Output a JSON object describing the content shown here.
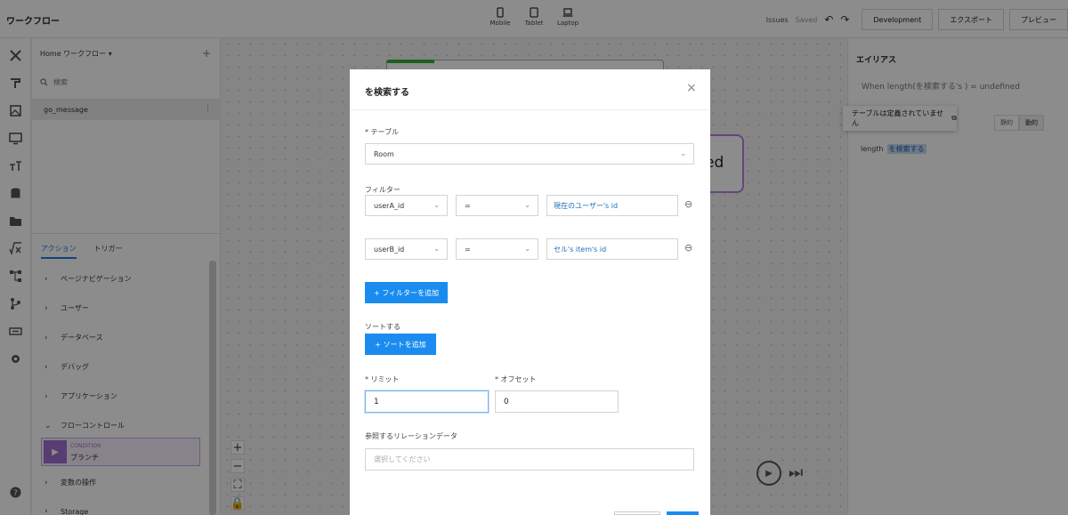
{
  "app": {
    "title": "ワークフロー"
  },
  "devices": [
    {
      "label": "Mobile",
      "icon": "mobile-icon"
    },
    {
      "label": "Tablet",
      "icon": "tablet-icon"
    },
    {
      "label": "Laptop",
      "icon": "laptop-icon"
    }
  ],
  "header": {
    "issues": "Issues",
    "saved": "Saved",
    "undo_icon": "↶",
    "redo_icon": "↷",
    "development": "Development",
    "export": "エクスポート",
    "preview": "プレビュー"
  },
  "left_panel": {
    "header": "Home ワークフロー ▾",
    "add": "+",
    "search_placeholder": "検索",
    "workflow_item": "go_message",
    "workflow_item_menu": "⋮",
    "tabs": [
      "アクション",
      "トリガー"
    ],
    "categories": [
      {
        "chevron": "›",
        "label": "ページナビゲーション"
      },
      {
        "chevron": "›",
        "label": "ユーザー"
      },
      {
        "chevron": "›",
        "label": "データベース"
      },
      {
        "chevron": "›",
        "label": "デバッグ"
      },
      {
        "chevron": "›",
        "label": "アプリケーション"
      },
      {
        "chevron": "⌄",
        "label": "フローコントロール"
      },
      {
        "chevron": "›",
        "label": "変数の操作"
      },
      {
        "chevron": "›",
        "label": "Storage"
      }
    ],
    "branch": {
      "sub": "CONDITION",
      "label": "ブランチ"
    }
  },
  "canvas": {
    "card_text": "ed",
    "zoom": [
      "+",
      "−",
      "⛶",
      "🔒"
    ]
  },
  "right_panel": {
    "title": "エイリアス",
    "when": "When length(を検索する's ) = undefined",
    "toggle": [
      "静的",
      "動的"
    ],
    "length_prefix": "length",
    "length_highlight": "を検索する",
    "tooltip": "テーブルは定義されていません"
  },
  "modal": {
    "title": "を検索する",
    "close": "×",
    "table_label": "* テーブル",
    "table_value": "Room",
    "filter_label": "フィルター",
    "filters": [
      {
        "field": "userA_id",
        "op": "=",
        "value": "現在のユーザー's id"
      },
      {
        "field": "userB_id",
        "op": "=",
        "value": "セル's item's id"
      }
    ],
    "add_filter": "+ フィルターを追加",
    "sort_label": "ソートする",
    "add_sort": "+ ソートを追加",
    "limit_label": "* リミット",
    "limit_value": "1",
    "offset_label": "* オフセット",
    "offset_value": "0",
    "relation_label": "参照するリレーションデータ",
    "relation_placeholder": "選択してください"
  },
  "colors": {
    "accent": "#1a8cf0",
    "purple": "#b87fe0"
  }
}
